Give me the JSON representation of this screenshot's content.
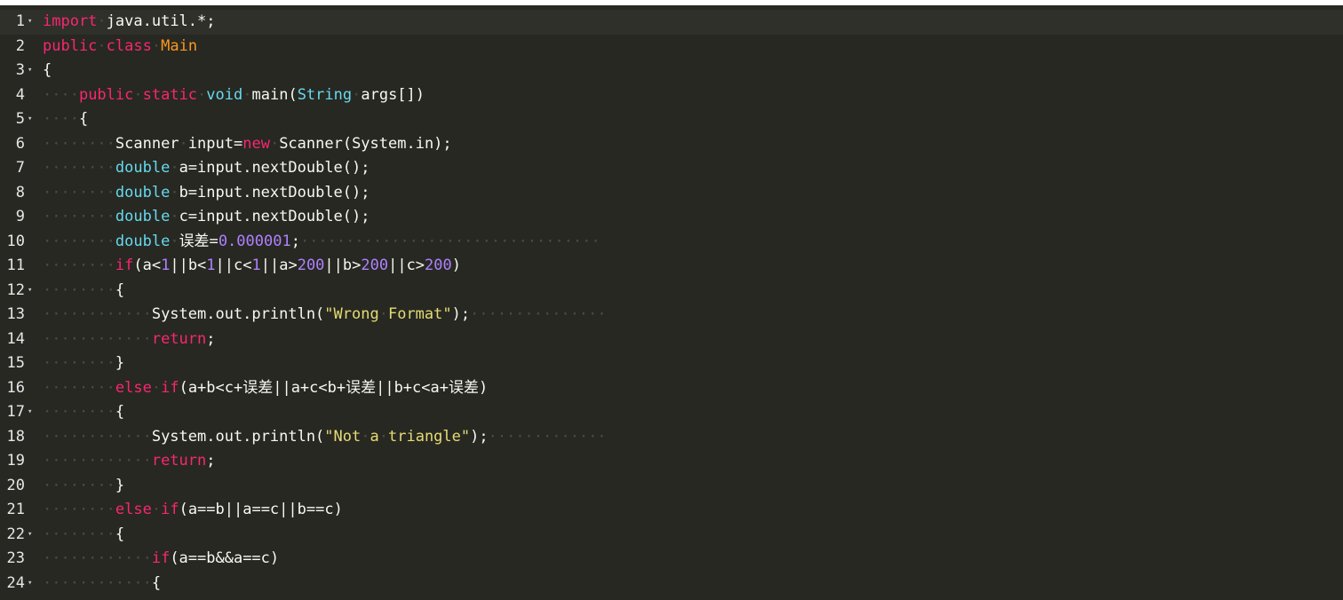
{
  "editor": {
    "lines": [
      {
        "n": "1",
        "fold": "▾",
        "tokens": [
          [
            "kw",
            "import"
          ],
          [
            "d",
            "·"
          ],
          [
            "id",
            "java.util.*;"
          ]
        ]
      },
      {
        "n": "2",
        "fold": "",
        "tokens": [
          [
            "kw",
            "public"
          ],
          [
            "d",
            "·"
          ],
          [
            "kw",
            "class"
          ],
          [
            "d",
            "·"
          ],
          [
            "cls",
            "Main"
          ]
        ]
      },
      {
        "n": "3",
        "fold": "▾",
        "tokens": [
          [
            "id",
            "{"
          ]
        ]
      },
      {
        "n": "4",
        "fold": "",
        "tokens": [
          [
            "d",
            "····"
          ],
          [
            "kw",
            "public"
          ],
          [
            "d",
            "·"
          ],
          [
            "kw",
            "static"
          ],
          [
            "d",
            "·"
          ],
          [
            "ty",
            "void"
          ],
          [
            "d",
            "·"
          ],
          [
            "id",
            "main("
          ],
          [
            "ty",
            "String"
          ],
          [
            "d",
            "·"
          ],
          [
            "id",
            "args[])"
          ]
        ]
      },
      {
        "n": "5",
        "fold": "▾",
        "tokens": [
          [
            "d",
            "····"
          ],
          [
            "id",
            "{"
          ]
        ]
      },
      {
        "n": "6",
        "fold": "",
        "tokens": [
          [
            "d",
            "········"
          ],
          [
            "id",
            "Scanner"
          ],
          [
            "d",
            "·"
          ],
          [
            "id",
            "input="
          ],
          [
            "kw",
            "new"
          ],
          [
            "d",
            "·"
          ],
          [
            "id",
            "Scanner(System.in);"
          ]
        ]
      },
      {
        "n": "7",
        "fold": "",
        "tokens": [
          [
            "d",
            "········"
          ],
          [
            "ty",
            "double"
          ],
          [
            "d",
            "·"
          ],
          [
            "id",
            "a=input.nextDouble();"
          ]
        ]
      },
      {
        "n": "8",
        "fold": "",
        "tokens": [
          [
            "d",
            "········"
          ],
          [
            "ty",
            "double"
          ],
          [
            "d",
            "·"
          ],
          [
            "id",
            "b=input.nextDouble();"
          ]
        ]
      },
      {
        "n": "9",
        "fold": "",
        "tokens": [
          [
            "d",
            "········"
          ],
          [
            "ty",
            "double"
          ],
          [
            "d",
            "·"
          ],
          [
            "id",
            "c=input.nextDouble();"
          ]
        ]
      },
      {
        "n": "10",
        "fold": "",
        "tokens": [
          [
            "d",
            "········"
          ],
          [
            "ty",
            "double"
          ],
          [
            "d",
            "·"
          ],
          [
            "id",
            "误差="
          ],
          [
            "num",
            "0.000001"
          ],
          [
            "id",
            ";"
          ],
          [
            "d",
            "·································"
          ]
        ]
      },
      {
        "n": "11",
        "fold": "",
        "tokens": [
          [
            "d",
            "········"
          ],
          [
            "kw",
            "if"
          ],
          [
            "id",
            "(a<"
          ],
          [
            "num",
            "1"
          ],
          [
            "id",
            "||b<"
          ],
          [
            "num",
            "1"
          ],
          [
            "id",
            "||c<"
          ],
          [
            "num",
            "1"
          ],
          [
            "id",
            "||a>"
          ],
          [
            "num",
            "200"
          ],
          [
            "id",
            "||b>"
          ],
          [
            "num",
            "200"
          ],
          [
            "id",
            "||c>"
          ],
          [
            "num",
            "200"
          ],
          [
            "id",
            ")"
          ]
        ]
      },
      {
        "n": "12",
        "fold": "▾",
        "tokens": [
          [
            "d",
            "········"
          ],
          [
            "id",
            "{"
          ]
        ]
      },
      {
        "n": "13",
        "fold": "",
        "tokens": [
          [
            "d",
            "············"
          ],
          [
            "id",
            "System.out.println("
          ],
          [
            "str",
            "\"Wrong"
          ],
          [
            "d",
            "·"
          ],
          [
            "str",
            "Format\""
          ],
          [
            "id",
            ");"
          ],
          [
            "d",
            "···············"
          ]
        ]
      },
      {
        "n": "14",
        "fold": "",
        "tokens": [
          [
            "d",
            "············"
          ],
          [
            "kw",
            "return"
          ],
          [
            "id",
            ";"
          ]
        ]
      },
      {
        "n": "15",
        "fold": "",
        "tokens": [
          [
            "d",
            "········"
          ],
          [
            "id",
            "}"
          ]
        ]
      },
      {
        "n": "16",
        "fold": "",
        "tokens": [
          [
            "d",
            "········"
          ],
          [
            "kw",
            "else"
          ],
          [
            "d",
            "·"
          ],
          [
            "kw",
            "if"
          ],
          [
            "id",
            "(a+b<c+误差||a+c<b+误差||b+c<a+误差)"
          ]
        ]
      },
      {
        "n": "17",
        "fold": "▾",
        "tokens": [
          [
            "d",
            "········"
          ],
          [
            "id",
            "{"
          ]
        ]
      },
      {
        "n": "18",
        "fold": "",
        "tokens": [
          [
            "d",
            "············"
          ],
          [
            "id",
            "System.out.println("
          ],
          [
            "str",
            "\"Not"
          ],
          [
            "d",
            "·"
          ],
          [
            "str",
            "a"
          ],
          [
            "d",
            "·"
          ],
          [
            "str",
            "triangle\""
          ],
          [
            "id",
            ");"
          ],
          [
            "d",
            "·············"
          ]
        ]
      },
      {
        "n": "19",
        "fold": "",
        "tokens": [
          [
            "d",
            "············"
          ],
          [
            "kw",
            "return"
          ],
          [
            "id",
            ";"
          ]
        ]
      },
      {
        "n": "20",
        "fold": "",
        "tokens": [
          [
            "d",
            "········"
          ],
          [
            "id",
            "}"
          ]
        ]
      },
      {
        "n": "21",
        "fold": "",
        "tokens": [
          [
            "d",
            "········"
          ],
          [
            "kw",
            "else"
          ],
          [
            "d",
            "·"
          ],
          [
            "kw",
            "if"
          ],
          [
            "id",
            "(a==b||a==c||b==c)"
          ]
        ]
      },
      {
        "n": "22",
        "fold": "▾",
        "tokens": [
          [
            "d",
            "········"
          ],
          [
            "id",
            "{"
          ]
        ]
      },
      {
        "n": "23",
        "fold": "",
        "tokens": [
          [
            "d",
            "············"
          ],
          [
            "kw",
            "if"
          ],
          [
            "id",
            "(a==b&&a==c)"
          ]
        ]
      },
      {
        "n": "24",
        "fold": "▾",
        "tokens": [
          [
            "d",
            "············"
          ],
          [
            "id",
            "{"
          ]
        ]
      }
    ]
  },
  "colors": {
    "background": "#272822",
    "keyword": "#f92672",
    "type": "#66d9ef",
    "class_name": "#fd971f",
    "number": "#ae81ff",
    "string": "#e6db74",
    "text": "#f8f8f2"
  }
}
